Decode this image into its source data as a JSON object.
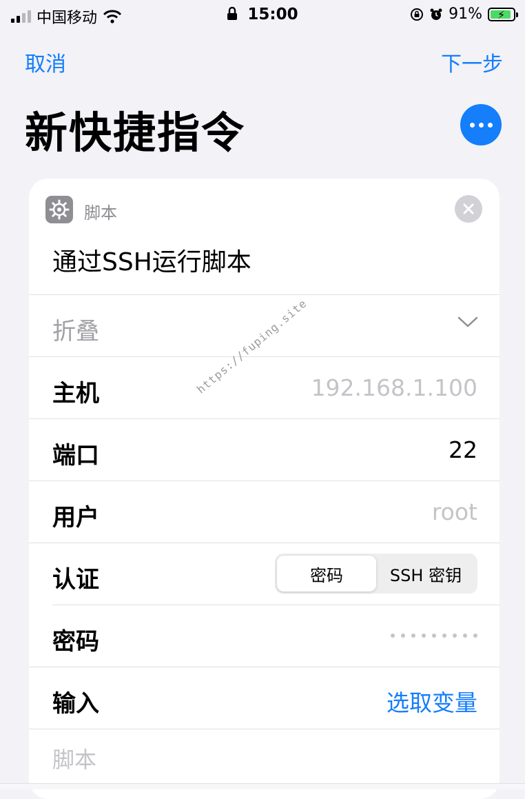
{
  "status_bar": {
    "carrier": "中国移动",
    "time": "15:00",
    "battery": "91%"
  },
  "nav": {
    "cancel": "取消",
    "next": "下一步"
  },
  "page_title": "新快捷指令",
  "card": {
    "category": "脚本",
    "action_title": "通过SSH运行脚本",
    "collapse_label": "折叠",
    "fields": {
      "host": {
        "label": "主机",
        "placeholder": "192.168.1.100"
      },
      "port": {
        "label": "端口",
        "value": "22"
      },
      "user": {
        "label": "用户",
        "placeholder": "root"
      },
      "auth": {
        "label": "认证",
        "options": [
          "密码",
          "SSH 密钥"
        ],
        "selected": "密码"
      },
      "password": {
        "label": "密码"
      },
      "input": {
        "label": "输入",
        "action": "选取变量"
      }
    },
    "script_placeholder": "脚本"
  },
  "watermark": "https://fuping.site",
  "colors": {
    "accent": "#147efb",
    "background": "#f2f2f7"
  },
  "icons": [
    "signal-icon",
    "wifi-icon",
    "lock-icon",
    "orientation-lock-icon",
    "alarm-icon",
    "battery-icon",
    "gear-icon",
    "close-icon",
    "chevron-down-icon",
    "more-icon"
  ]
}
